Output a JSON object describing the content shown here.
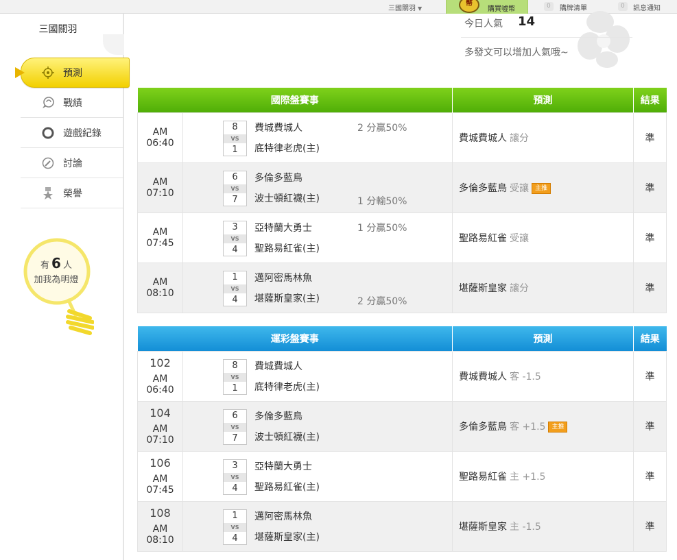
{
  "topbar": {
    "user": "三國關羽",
    "coin_glyph": "幣",
    "buy_coin": "購買噓幣",
    "cart_count": "0",
    "cart": "購牌清單",
    "notice_count": "0",
    "notice": "訊息通知"
  },
  "sidebar": {
    "username": "三國關羽",
    "menu": [
      {
        "label": "預測",
        "icon": "target-icon",
        "active": true
      },
      {
        "label": "戰績",
        "icon": "chat-bubble-icon"
      },
      {
        "label": "遊戲紀錄",
        "icon": "ring-icon"
      },
      {
        "label": "討論",
        "icon": "pencil-bubble-icon"
      },
      {
        "label": "榮譽",
        "icon": "medal-icon"
      }
    ],
    "fans_prefix": "有",
    "fans_count": "6",
    "fans_suffix": "人",
    "fans_text": "加我為明燈"
  },
  "popularity": {
    "label": "今日人氣",
    "value": "14",
    "tip": "多發文可以增加人氣哦~"
  },
  "intl_table": {
    "headers": [
      "國際盤賽事",
      "預測",
      "結果"
    ],
    "rows": [
      {
        "time": "AM 06:40",
        "score1": "8",
        "score2": "1",
        "team1": "費城費城人",
        "team2": "底特律老虎(主)",
        "odds_top": "2 分贏50%",
        "odds_bot": "",
        "pick": "費城費城人",
        "pick_type": "讓分",
        "badge": "",
        "result": "準"
      },
      {
        "time": "AM 07:10",
        "score1": "6",
        "score2": "7",
        "team1": "多倫多藍鳥",
        "team2": "波士頓紅襪(主)",
        "odds_top": "",
        "odds_bot": "1 分輸50%",
        "pick": "多倫多藍鳥",
        "pick_type": "受讓",
        "badge": "主推",
        "result": "準"
      },
      {
        "time": "AM 07:45",
        "score1": "3",
        "score2": "4",
        "team1": "亞特蘭大勇士",
        "team2": "聖路易紅雀(主)",
        "odds_top": "1 分贏50%",
        "odds_bot": "",
        "pick": "聖路易紅雀",
        "pick_type": "受讓",
        "badge": "",
        "result": "準"
      },
      {
        "time": "AM 08:10",
        "score1": "1",
        "score2": "4",
        "team1": "邁阿密馬林魚",
        "team2": "堪薩斯皇家(主)",
        "odds_top": "",
        "odds_bot": "2 分贏50%",
        "pick": "堪薩斯皇家",
        "pick_type": "讓分",
        "badge": "",
        "result": "準"
      }
    ]
  },
  "lottery_table": {
    "headers": [
      "運彩盤賽事",
      "預測",
      "結果"
    ],
    "rows": [
      {
        "num": "102",
        "time": "AM 06:40",
        "score1": "8",
        "score2": "1",
        "team1": "費城費城人",
        "team2": "底特律老虎(主)",
        "pick": "費城費城人",
        "pick_type": "客 -1.5",
        "badge": "",
        "result": "準"
      },
      {
        "num": "104",
        "time": "AM 07:10",
        "score1": "6",
        "score2": "7",
        "team1": "多倫多藍鳥",
        "team2": "波士頓紅襪(主)",
        "pick": "多倫多藍鳥",
        "pick_type": "客 +1.5",
        "badge": "主推",
        "result": "準"
      },
      {
        "num": "106",
        "time": "AM 07:45",
        "score1": "3",
        "score2": "4",
        "team1": "亞特蘭大勇士",
        "team2": "聖路易紅雀(主)",
        "pick": "聖路易紅雀",
        "pick_type": "主 +1.5",
        "badge": "",
        "result": "準"
      },
      {
        "num": "108",
        "time": "AM 08:10",
        "score1": "1",
        "score2": "4",
        "team1": "邁阿密馬林魚",
        "team2": "堪薩斯皇家(主)",
        "pick": "堪薩斯皇家",
        "pick_type": "主 -1.5",
        "badge": "",
        "result": "準"
      }
    ]
  },
  "vs_label": "VS",
  "colors": {
    "intl_header": "#5cb80d",
    "lottery_header": "#1e9be0",
    "result": "#2e9a2e",
    "active_menu": "#f5d800",
    "badge": "#f29e1c"
  }
}
